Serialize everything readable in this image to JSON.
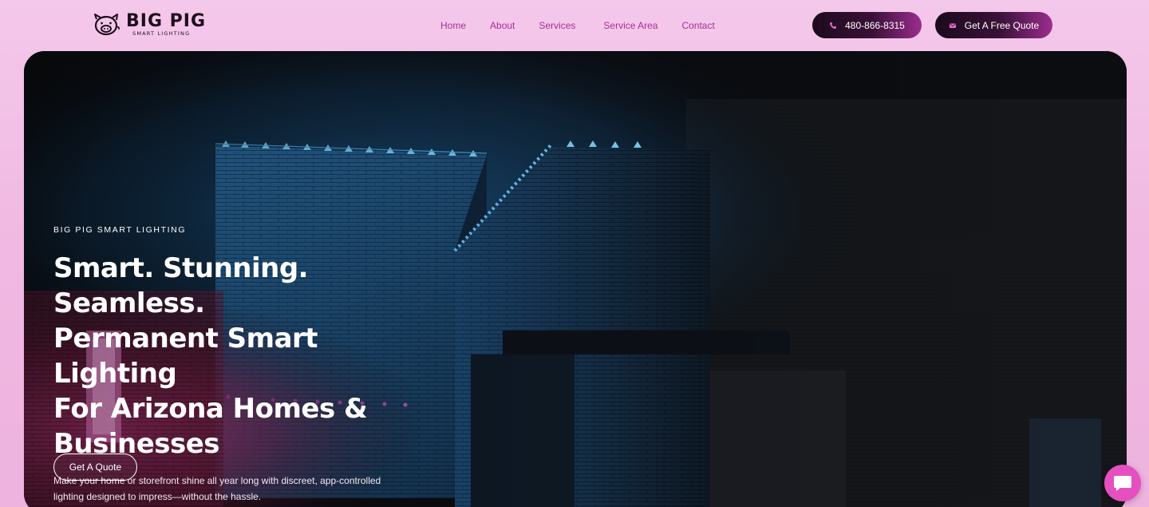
{
  "brand": {
    "name": "BIG PIG",
    "tagline": "SMART LIGHTING"
  },
  "nav": {
    "items": [
      {
        "label": "Home"
      },
      {
        "label": "About"
      },
      {
        "label": "Services",
        "has_dropdown": true
      },
      {
        "label": "Service Area"
      },
      {
        "label": "Contact"
      }
    ]
  },
  "header_buttons": {
    "phone": {
      "label": "480-866-8315",
      "icon": "phone-icon"
    },
    "quote": {
      "label": "Get A Free Quote",
      "icon": "mail-icon"
    }
  },
  "hero": {
    "eyebrow": "BIG PIG SMART LIGHTING",
    "headline": "Smart. Stunning. Seamless.\nPermanent Smart Lighting\nFor Arizona Homes &\nBusinesses",
    "subtext": "Make your home or storefront shine all year long with discreet, app-controlled lighting designed to impress—without the hassle.",
    "cta_label": "Get A Quote"
  },
  "chat": {
    "icon": "chat-bubble-icon"
  },
  "colors": {
    "nav_link": "#a3319a",
    "button_dark": "#1c0a1c",
    "button_accent": "#9b2d8e",
    "page_bg": "#f4c8ea",
    "chat_bg": "#e64fc0"
  }
}
